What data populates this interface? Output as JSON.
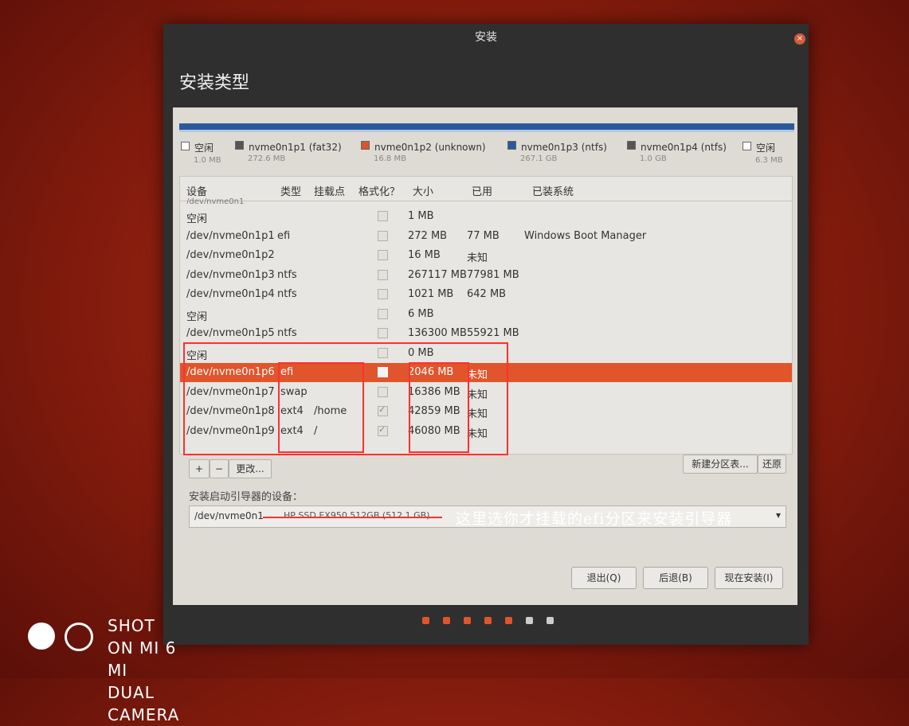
{
  "window": {
    "title": "安装",
    "close_glyph": "×"
  },
  "page": {
    "title": "安装类型"
  },
  "legend": [
    {
      "label": "空闲",
      "size": "1.0 MB",
      "color": "#ffffff"
    },
    {
      "label": "nvme0n1p1 (fat32)",
      "size": "272.6 MB",
      "color": "#555555"
    },
    {
      "label": "nvme0n1p2 (unknown)",
      "size": "16.8 MB",
      "color": "#d9552b"
    },
    {
      "label": "nvme0n1p3 (ntfs)",
      "size": "267.1 GB",
      "color": "#2a5a9c"
    },
    {
      "label": "nvme0n1p4 (ntfs)",
      "size": "1.0 GB",
      "color": "#555555"
    },
    {
      "label": "空闲",
      "size": "6.3 MB",
      "color": "#ffffff"
    }
  ],
  "table": {
    "headers": [
      "设备",
      "类型",
      "挂载点",
      "格式化？",
      "大小",
      "已用",
      "已装系统"
    ],
    "partial_row": "/dev/nvme0n1",
    "rows": [
      {
        "device": "空闲",
        "type": "",
        "mount": "",
        "format": false,
        "size": "1 MB",
        "used": "",
        "system": ""
      },
      {
        "device": "/dev/nvme0n1p1",
        "type": "efi",
        "mount": "",
        "format": false,
        "size": "272 MB",
        "used": "77 MB",
        "system": "Windows Boot Manager"
      },
      {
        "device": "/dev/nvme0n1p2",
        "type": "",
        "mount": "",
        "format": false,
        "size": "16 MB",
        "used": "未知",
        "system": ""
      },
      {
        "device": "/dev/nvme0n1p3",
        "type": "ntfs",
        "mount": "",
        "format": false,
        "size": "267117 MB",
        "used": "77981 MB",
        "system": ""
      },
      {
        "device": "/dev/nvme0n1p4",
        "type": "ntfs",
        "mount": "",
        "format": false,
        "size": "1021 MB",
        "used": "642 MB",
        "system": ""
      },
      {
        "device": "空闲",
        "type": "",
        "mount": "",
        "format": false,
        "size": "6 MB",
        "used": "",
        "system": ""
      },
      {
        "device": "/dev/nvme0n1p5",
        "type": "ntfs",
        "mount": "",
        "format": false,
        "size": "136300 MB",
        "used": "55921 MB",
        "system": ""
      },
      {
        "device": "空闲",
        "type": "",
        "mount": "",
        "format": false,
        "size": "0 MB",
        "used": "",
        "system": ""
      },
      {
        "device": "/dev/nvme0n1p6",
        "type": "efi",
        "mount": "",
        "format": false,
        "size": "2046 MB",
        "used": "未知",
        "system": "",
        "selected": true
      },
      {
        "device": "/dev/nvme0n1p7",
        "type": "swap",
        "mount": "",
        "format": false,
        "size": "16386 MB",
        "used": "未知",
        "system": ""
      },
      {
        "device": "/dev/nvme0n1p8",
        "type": "ext4",
        "mount": "/home",
        "format": true,
        "size": "42859 MB",
        "used": "未知",
        "system": ""
      },
      {
        "device": "/dev/nvme0n1p9",
        "type": "ext4",
        "mount": "/",
        "format": true,
        "size": "46080 MB",
        "used": "未知",
        "system": ""
      }
    ]
  },
  "toolbar": {
    "add": "+",
    "remove": "−",
    "change": "更改...",
    "new_table": "新建分区表...",
    "revert": "还原"
  },
  "boot": {
    "label": "安装启动引导器的设备：",
    "device": "/dev/nvme0n1",
    "disk": "HP SSD EX950 512GB (512.1 GB)",
    "arrow": "▾"
  },
  "annotation": "这里选你才挂载的efi分区来安装引导器",
  "buttons": {
    "quit": "退出(Q)",
    "back": "后退(B)",
    "install": "现在安装(I)"
  },
  "progress": {
    "total": 7,
    "active": 5,
    "active_color": "#e0552c",
    "inactive_color": "#cccccc"
  },
  "watermark": {
    "line1": "SHOT ON MI 6",
    "line2": "MI DUAL CAMERA"
  }
}
